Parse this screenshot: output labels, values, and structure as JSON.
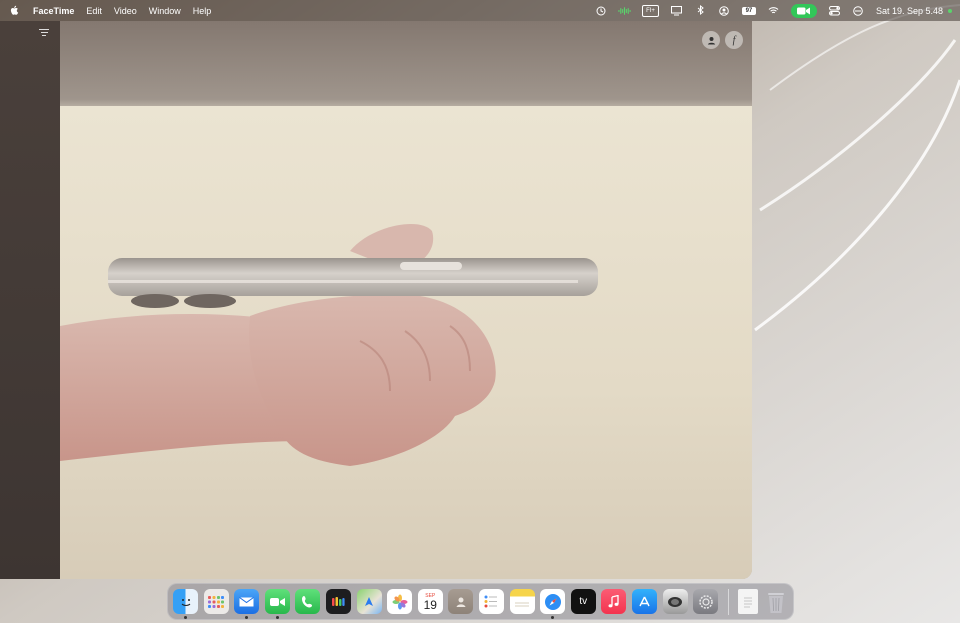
{
  "menubar": {
    "apple_icon": "apple-logo-icon",
    "app_name": "FaceTime",
    "menus": [
      "Edit",
      "Video",
      "Window",
      "Help"
    ],
    "status_icons": [
      "time-machine-icon",
      "audio-waveform-icon",
      "keyboard-input-icon",
      "display-mirroring-icon",
      "bluetooth-icon",
      "user-account-icon"
    ],
    "battery_text": "97",
    "input_label": "FI+",
    "datetime": "Sat 19. Sep  5.48",
    "accent": "#32c759"
  },
  "window": {
    "sidebar_button_icon": "sidebar-toggle-icon",
    "person_icon": "person-icon",
    "effects_icon": "effects-f-icon",
    "effects_glyph": "f"
  },
  "dock": {
    "apps": [
      {
        "name": "Finder",
        "icon": "finder-icon",
        "running": true
      },
      {
        "name": "Launchpad",
        "icon": "launchpad-icon",
        "running": false
      },
      {
        "name": "Mail",
        "icon": "mail-icon",
        "running": true
      },
      {
        "name": "FaceTime",
        "icon": "facetime-icon",
        "running": true
      },
      {
        "name": "Phone",
        "icon": "phone-icon",
        "running": false
      },
      {
        "name": "Game Center",
        "icon": "game-icon",
        "running": false
      },
      {
        "name": "Maps",
        "icon": "maps-icon",
        "running": false
      },
      {
        "name": "Photos",
        "icon": "photos-icon",
        "running": false
      },
      {
        "name": "Calendar",
        "icon": "calendar-icon",
        "running": false,
        "month": "SEP",
        "day": "19"
      },
      {
        "name": "Contacts",
        "icon": "contacts-icon",
        "running": false
      },
      {
        "name": "Reminders",
        "icon": "reminders-icon",
        "running": false
      },
      {
        "name": "Notes",
        "icon": "notes-icon",
        "running": false
      },
      {
        "name": "Safari",
        "icon": "safari-icon",
        "running": true
      },
      {
        "name": "TV",
        "icon": "apple-tv-icon",
        "running": false,
        "label": "tv"
      },
      {
        "name": "Music",
        "icon": "music-icon",
        "running": false
      },
      {
        "name": "App Store",
        "icon": "app-store-icon",
        "running": false
      },
      {
        "name": "Camera",
        "icon": "camera-icon",
        "running": false
      },
      {
        "name": "System Settings",
        "icon": "settings-icon",
        "running": false
      }
    ],
    "trailing": [
      {
        "name": "Document",
        "icon": "document-icon"
      },
      {
        "name": "Trash",
        "icon": "trash-icon"
      }
    ]
  }
}
